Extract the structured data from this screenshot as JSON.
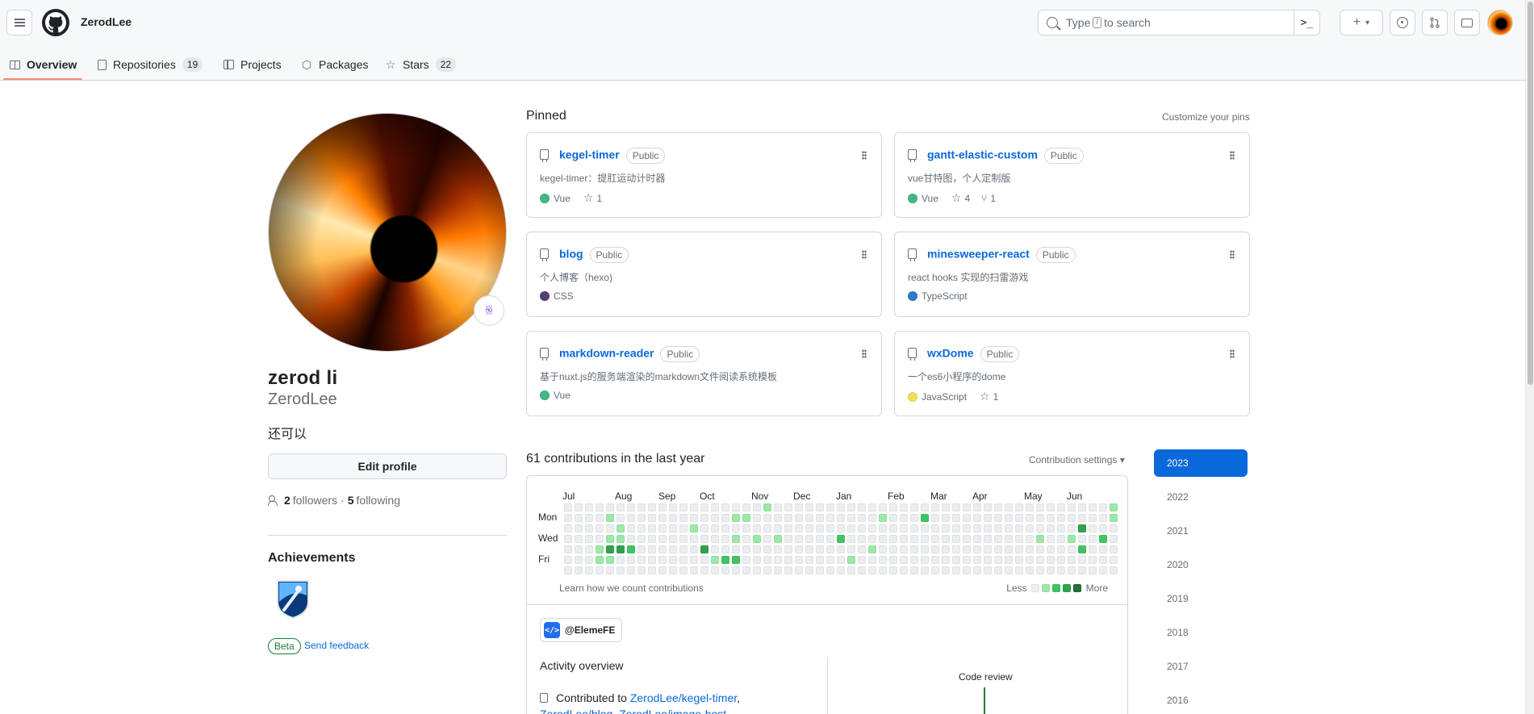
{
  "header": {
    "username": "ZerodLee",
    "search_prefix": "Type",
    "search_key": "/",
    "search_suffix": "to search",
    "cmd_icon": ">_",
    "plus": "+"
  },
  "tabs": [
    {
      "label": "Overview",
      "count": ""
    },
    {
      "label": "Repositories",
      "count": "19"
    },
    {
      "label": "Projects",
      "count": ""
    },
    {
      "label": "Packages",
      "count": ""
    },
    {
      "label": "Stars",
      "count": "22"
    }
  ],
  "profile": {
    "fullname": "zerod li",
    "login": "ZerodLee",
    "bio": "还可以",
    "edit_label": "Edit profile",
    "followers_count": "2",
    "followers_label": "followers",
    "separator": "·",
    "following_count": "5",
    "following_label": "following",
    "achievements_title": "Achievements",
    "beta_label": "Beta",
    "feedback_label": "Send feedback"
  },
  "pinned": {
    "title": "Pinned",
    "customize_label": "Customize your pins",
    "repos": [
      {
        "name": "kegel-timer",
        "visibility": "Public",
        "desc": "kegel-timer：提肛运动计时器",
        "language": "Vue",
        "lang_color": "#41b883",
        "stars": "1",
        "forks": ""
      },
      {
        "name": "gantt-elastic-custom",
        "visibility": "Public",
        "desc": "vue甘特图，个人定制版",
        "language": "Vue",
        "lang_color": "#41b883",
        "stars": "4",
        "forks": "1"
      },
      {
        "name": "blog",
        "visibility": "Public",
        "desc": "个人博客（hexo)",
        "language": "CSS",
        "lang_color": "#563d7c",
        "stars": "",
        "forks": ""
      },
      {
        "name": "minesweeper-react",
        "visibility": "Public",
        "desc": "react hooks 实现的扫雷游戏",
        "language": "TypeScript",
        "lang_color": "#3178c6",
        "stars": "",
        "forks": ""
      },
      {
        "name": "markdown-reader",
        "visibility": "Public",
        "desc": "基于nuxt.js的服务端渲染的markdown文件阅读系统模板",
        "language": "Vue",
        "lang_color": "#41b883",
        "stars": "",
        "forks": ""
      },
      {
        "name": "wxDome",
        "visibility": "Public",
        "desc": "一个es6小程序的dome",
        "language": "JavaScript",
        "lang_color": "#f1e05a",
        "stars": "1",
        "forks": ""
      }
    ]
  },
  "contributions": {
    "title": "61 contributions in the last year",
    "settings_label": "Contribution settings ▾",
    "months": [
      "Jul",
      "Aug",
      "Sep",
      "Oct",
      "Nov",
      "Dec",
      "Jan",
      "Feb",
      "Mar",
      "Apr",
      "May",
      "Jun"
    ],
    "days": [
      "Mon",
      "Wed",
      "Fri"
    ],
    "learn_label": "Learn how we count contributions",
    "less_label": "Less",
    "more_label": "More",
    "level_colors": [
      "#ebedf0",
      "#9be9a8",
      "#40c463",
      "#30a14e",
      "#216e39"
    ]
  },
  "activity": {
    "org": "@ElemeFE",
    "overview_title": "Activity overview",
    "contributed_prefix": "Contributed to",
    "repo1": "ZerodLee/kegel-timer",
    "repo2": "ZerodLee/blog",
    "repo3": "ZerodLee/image-host",
    "code_review_label": "Code review"
  },
  "years": [
    "2023",
    "2022",
    "2021",
    "2020",
    "2019",
    "2018",
    "2017",
    "2016"
  ]
}
